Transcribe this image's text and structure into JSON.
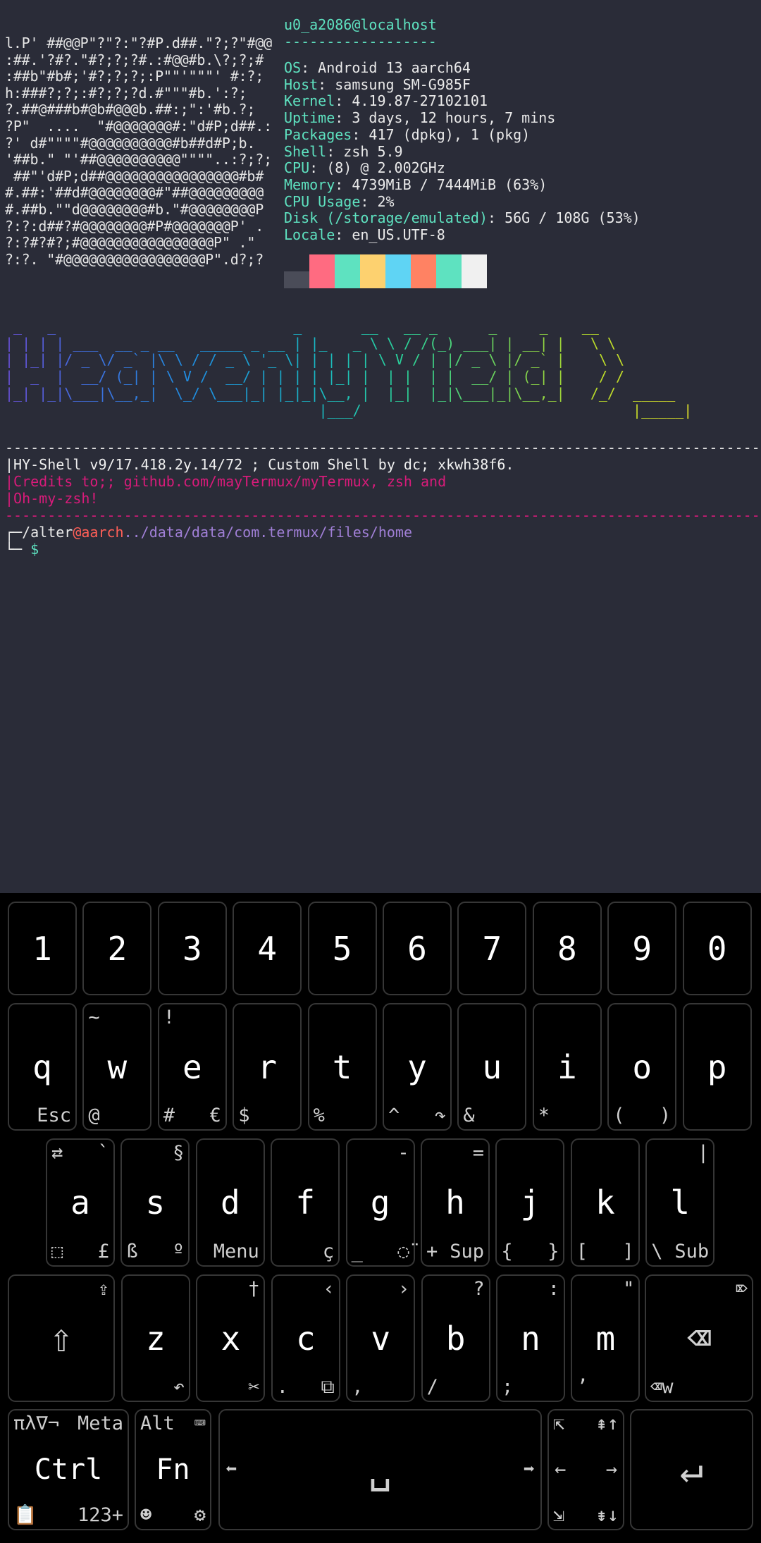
{
  "terminal": {
    "user_host": "u0_a2086@localhost",
    "separator": "------------------",
    "info": [
      {
        "key": "OS",
        "value": ": Android 13 aarch64"
      },
      {
        "key": "Host",
        "value": ": samsung SM-G985F"
      },
      {
        "key": "Kernel",
        "value": ": 4.19.87-27102101"
      },
      {
        "key": "Uptime",
        "value": ": 3 days, 12 hours, 7 mins"
      },
      {
        "key": "Packages",
        "value": ": 417 (dpkg), 1 (pkg)"
      },
      {
        "key": "Shell",
        "value": ": zsh 5.9"
      },
      {
        "key": "CPU",
        "value": ": (8) @ 2.002GHz"
      },
      {
        "key": "Memory",
        "value": ": 4739MiB / 7444MiB (63%)"
      },
      {
        "key": "CPU Usage",
        "value": ": 2%"
      },
      {
        "key": "Disk (/storage/emulated)",
        "value": ": 56G / 108G (53%)"
      },
      {
        "key": "Locale",
        "value": ": en_US.UTF-8"
      }
    ],
    "palette_top": [
      "#2a2c38",
      "#ff6b81",
      "#5ee2c0",
      "#fdd16f",
      "#5fd4f4",
      "#ff8263",
      "#5ee2c0",
      "#f0f0f0"
    ],
    "palette_bottom": [
      "#4a4c58",
      "#ff6b81",
      "#5ee2c0",
      "#fdd16f",
      "#5fd4f4",
      "#ff8263",
      "#5ee2c0",
      "#f0f0f0"
    ],
    "ascii_art": [
      "l.P' ##@@P\"?\"?:\"?#P.d##.\"?;?\"#@@",
      ":##.'?#?.\"#?;?;?#.:#@@#b.\\?;?;#",
      ":##b\"#b#;'#?;?;?;:P\"\"'\"\"\"' #:?;",
      "h:###?;?;:#?;?;?d.#\"\"\"#b.':?;",
      "?.##@###b#@b#@@@b.##:;\":'#b.?;",
      "?P\"  ....  \"#@@@@@@@#:\"d#P;d##.:",
      "?' d#\"\"\"\"#@@@@@@@@@@#b##d#P;b.",
      "'##b.\" \"'##@@@@@@@@@@\"\"\"\"..:?;?;",
      " ##\"'d#P;d##@@@@@@@@@@@@@@@@#b#",
      "#.##:'##d#@@@@@@@@#\"##@@@@@@@@@",
      "#.##b.\"\"d@@@@@@@@#b.\"#@@@@@@@@P",
      "?:?:d##?#@@@@@@@@#P#@@@@@@@P' .",
      "?:?#?#?;#@@@@@@@@@@@@@@@@P\" .\"",
      "?:?. \"#@@@@@@@@@@@@@@@@@P\".d?;?"
    ],
    "banner": [
      " _   _                            _       __   __ _      _     _    __",
      "| | | | ___  __ _ __   _____ _ __ | |_   _ \\ \\ / /(_) ___| | __| |   \\ \\",
      "| |_| |/ _ \\/ _` |\\ \\ / / _ \\ '_ \\| | | | | \\ V / | |/ _ \\ |/ _` |    \\ \\",
      "|  _  |  __/ (_| | \\ V /  __/ | | | | |_| |  | |  | |  __/ | (_| |    / /",
      "|_| |_|\\___|\\__,_|  \\_/ \\___|_| |_|_|\\__, |  |_|  |_|\\___|_|\\__,_|   /_/  _____",
      "                                     |___/                                |_____|"
    ],
    "rule": "------------------------------------------------------------------------------------------",
    "motd": "|HY-Shell v9/17.418.2y.14/72 ; Custom Shell by dc; xkwh38f6.",
    "credits_1": "|Credits to;; github.com/mayTermux/myTermux, zsh and",
    "credits_2": "|Oh-my-zsh!",
    "prompt": {
      "corner_top": "┌─",
      "user": "/alter",
      "host": "@aarch",
      "path": "../data/data/com.termux/files/home",
      "corner_bottom": "└─ ",
      "symbol": "$"
    }
  },
  "keyboard": {
    "rows": [
      [
        {
          "name": "1",
          "main": "1"
        },
        {
          "name": "2",
          "main": "2"
        },
        {
          "name": "3",
          "main": "3"
        },
        {
          "name": "4",
          "main": "4"
        },
        {
          "name": "5",
          "main": "5"
        },
        {
          "name": "6",
          "main": "6"
        },
        {
          "name": "7",
          "main": "7"
        },
        {
          "name": "8",
          "main": "8"
        },
        {
          "name": "9",
          "main": "9"
        },
        {
          "name": "0",
          "main": "0"
        }
      ],
      [
        {
          "name": "q",
          "main": "q",
          "br": "Esc"
        },
        {
          "name": "w",
          "main": "w",
          "tl": "~",
          "bl": "@"
        },
        {
          "name": "e",
          "main": "e",
          "tl": "!",
          "bl": "#",
          "br": "€"
        },
        {
          "name": "r",
          "main": "r",
          "bl": "$"
        },
        {
          "name": "t",
          "main": "t",
          "bl": "%"
        },
        {
          "name": "y",
          "main": "y",
          "bl": "^",
          "br": "↷"
        },
        {
          "name": "u",
          "main": "u",
          "bl": "&"
        },
        {
          "name": "i",
          "main": "i",
          "bl": "*"
        },
        {
          "name": "o",
          "main": "o",
          "bl": "(",
          "br": ")"
        },
        {
          "name": "p",
          "main": "p"
        }
      ],
      [
        {
          "name": "a",
          "main": "a",
          "tl": "⇄",
          "tr": "`",
          "bl": "⬚",
          "br": "£"
        },
        {
          "name": "s",
          "main": "s",
          "tr": "§",
          "bl": "ß",
          "br": "º"
        },
        {
          "name": "d",
          "main": "d",
          "br": "Menu"
        },
        {
          "name": "f",
          "main": "f",
          "br": "ç"
        },
        {
          "name": "g",
          "main": "g",
          "tr": "-",
          "bl": "_",
          "br": "◌̈"
        },
        {
          "name": "h",
          "main": "h",
          "tr": "=",
          "bl": "+",
          "br": "Sup"
        },
        {
          "name": "j",
          "main": "j",
          "bl": "{",
          "br": "}"
        },
        {
          "name": "k",
          "main": "k",
          "bl": "[",
          "br": "]"
        },
        {
          "name": "l",
          "main": "l",
          "tr": "|",
          "bl": "\\",
          "br": "Sub"
        }
      ],
      [
        {
          "name": "shift",
          "main": "⇧",
          "tr": "⇪",
          "icon": true
        },
        {
          "name": "z",
          "main": "z",
          "br": "↶"
        },
        {
          "name": "x",
          "main": "x",
          "tr": "†",
          "br": "✂"
        },
        {
          "name": "c",
          "main": "c",
          "tr": "‹",
          "bl": ".",
          "br": "⧉"
        },
        {
          "name": "v",
          "main": "v",
          "tr": "›",
          "bl": ","
        },
        {
          "name": "b",
          "main": "b",
          "tr": "?",
          "bl": "/"
        },
        {
          "name": "n",
          "main": "n",
          "tr": ":",
          "bl": ";"
        },
        {
          "name": "m",
          "main": "m",
          "tr": "\"",
          "bl": "’"
        },
        {
          "name": "backspace",
          "main": "⌫",
          "tr": "⌦",
          "bl": "⌫w",
          "icon": true
        }
      ],
      [
        {
          "name": "ctrl",
          "main": "Ctrl",
          "tl": "πλ∇¬",
          "tr": "Meta",
          "bl": "📋",
          "br": "123+"
        },
        {
          "name": "fn",
          "main": "Fn",
          "tl": "Alt",
          "tr": "⌨",
          "bl": "☻",
          "br": "⚙"
        },
        {
          "name": "space",
          "main": "␣",
          "ml": "⬅",
          "mr": "➡",
          "icon": true
        },
        {
          "name": "navigation",
          "main": "",
          "tl": "⇱",
          "tr": "⇞↑",
          "ml": "←",
          "mr": "→",
          "bl": "⇲",
          "br": "⇟↓"
        },
        {
          "name": "enter",
          "main": "↵",
          "icon": true
        }
      ]
    ]
  }
}
